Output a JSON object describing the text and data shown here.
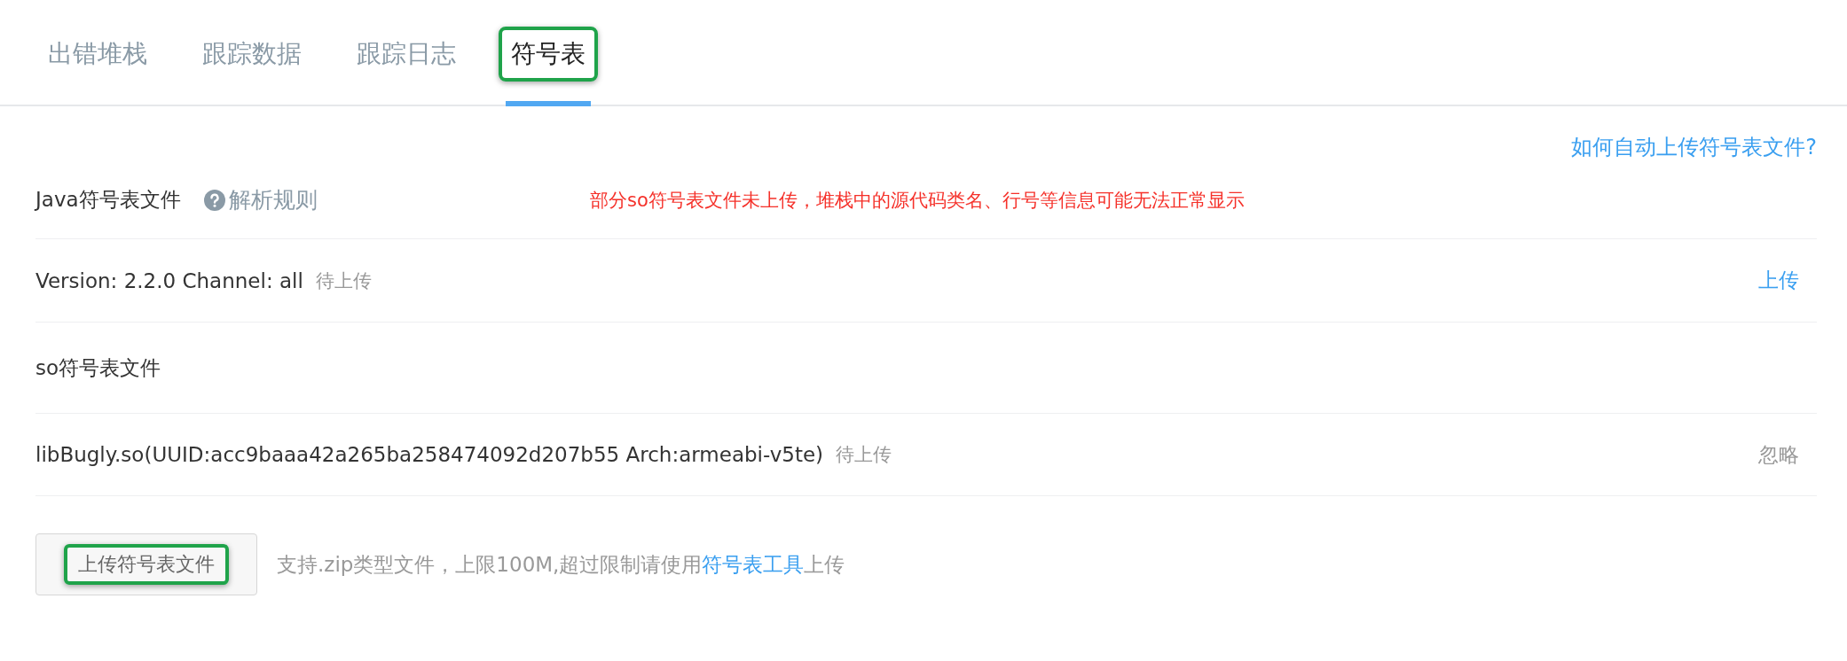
{
  "tabs": [
    {
      "label": "出错堆栈",
      "selected": false,
      "highlighted": false
    },
    {
      "label": "跟踪数据",
      "selected": false,
      "highlighted": false
    },
    {
      "label": "跟踪日志",
      "selected": false,
      "highlighted": false
    },
    {
      "label": "符号表",
      "selected": true,
      "highlighted": true
    }
  ],
  "help_link": "如何自动上传符号表文件?",
  "java_section": {
    "title": "Java符号表文件",
    "rules_link": "解析规则",
    "warning": "部分so符号表文件未上传，堆栈中的源代码类名、行号等信息可能无法正常显示"
  },
  "java_files": [
    {
      "name": "Version: 2.2.0 Channel: all",
      "status": "待上传",
      "action": "上传",
      "kind": "link"
    }
  ],
  "so_section": {
    "title": "so符号表文件"
  },
  "so_files": [
    {
      "name": "libBugly.so(UUID:acc9baaa42a265ba258474092d207b55 Arch:armeabi-v5te)",
      "status": "待上传",
      "action": "忽略",
      "kind": "muted"
    }
  ],
  "upload": {
    "button": "上传符号表文件",
    "button_highlighted": true,
    "hint": "支持.zip类型文件，上限100M,超过限制请使用",
    "tool_link": "符号表工具",
    "hint_end": "上传"
  }
}
